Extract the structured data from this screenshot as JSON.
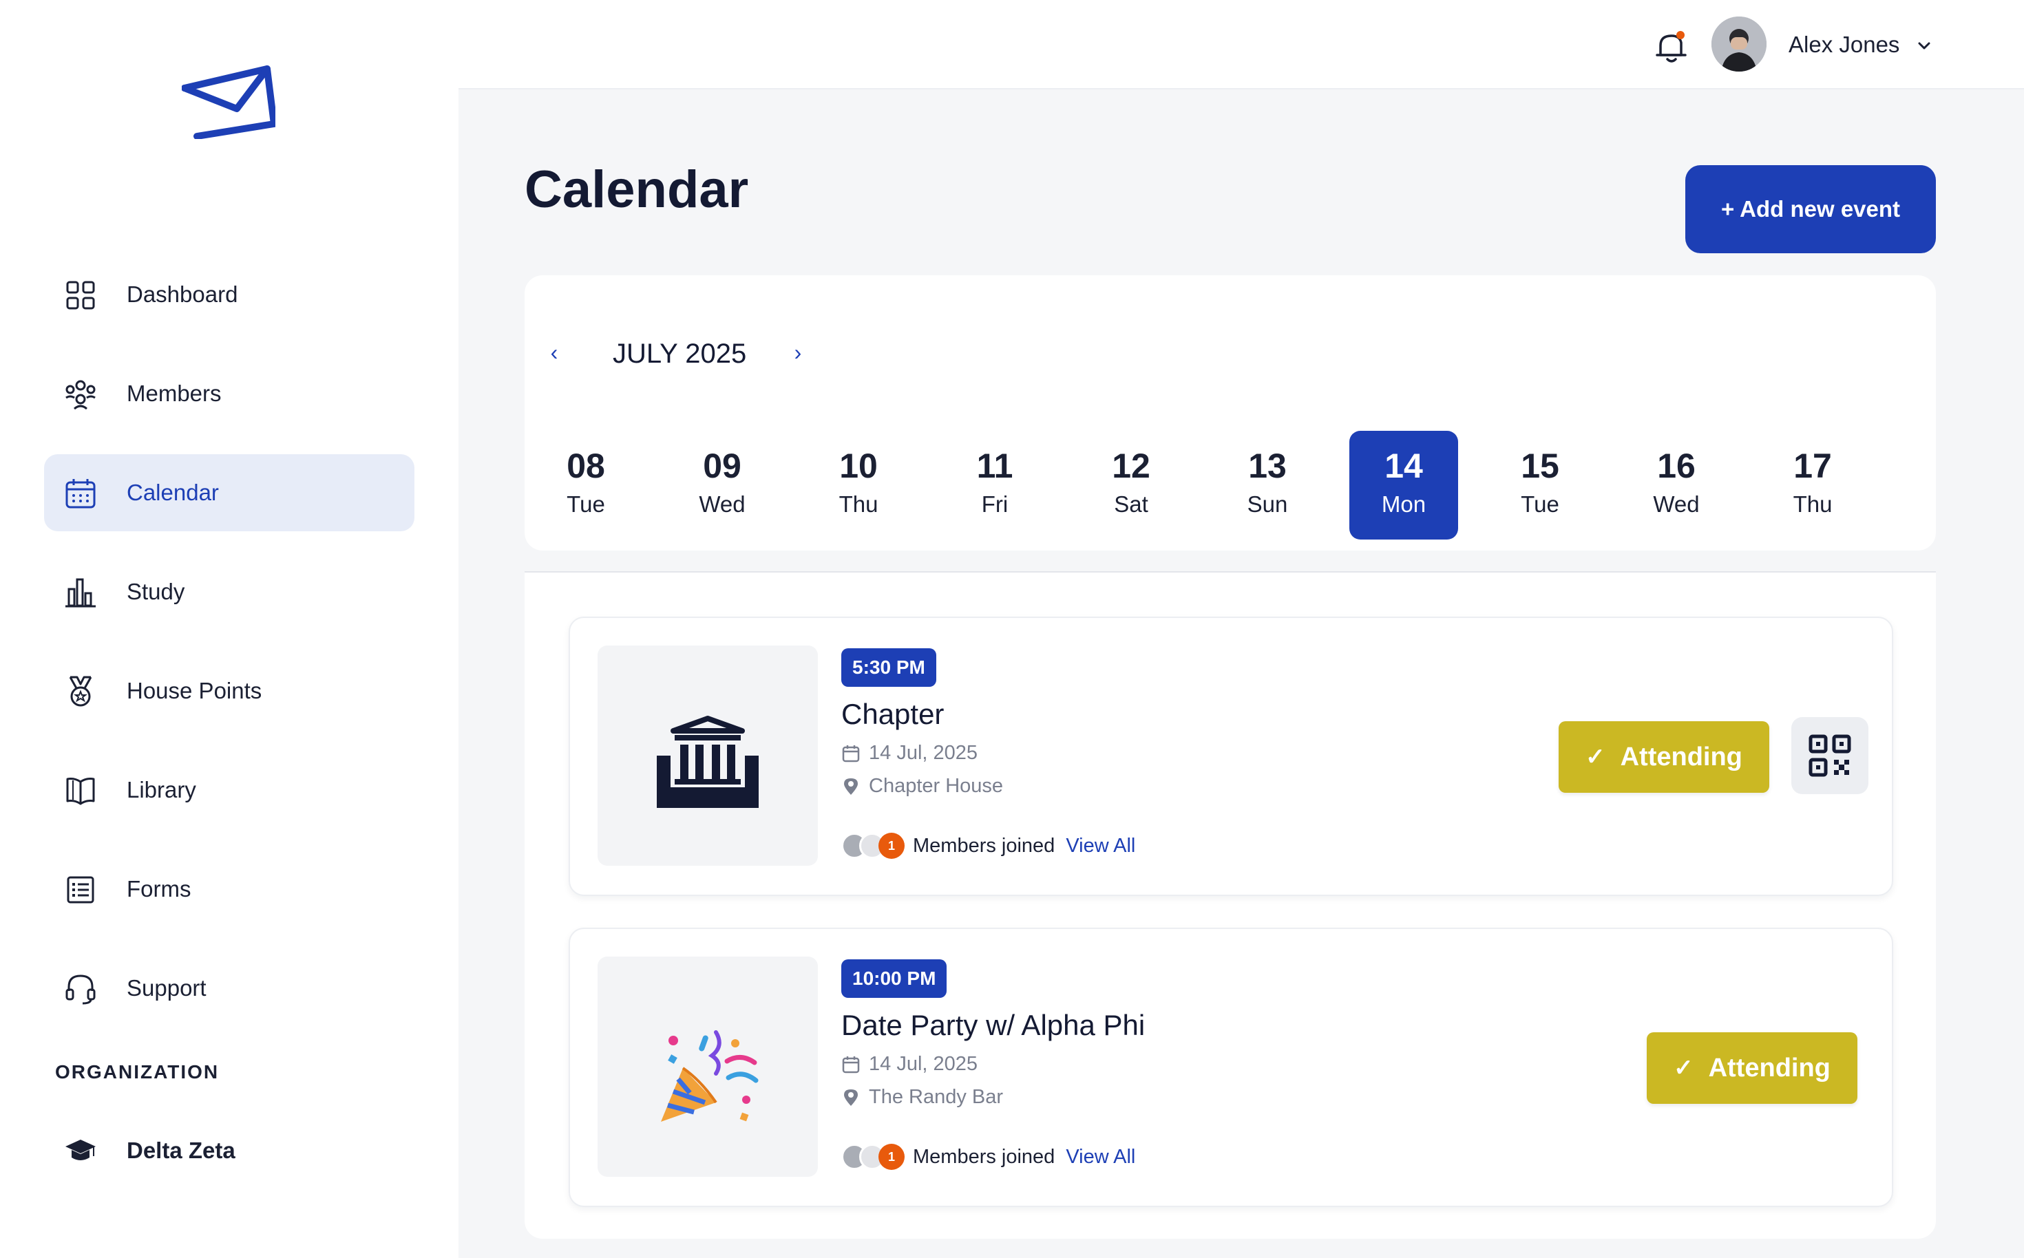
{
  "sidebar": {
    "nav": [
      {
        "label": "Dashboard",
        "icon": "grid-icon"
      },
      {
        "label": "Members",
        "icon": "members-icon"
      },
      {
        "label": "Calendar",
        "icon": "calendar-icon",
        "active": true
      },
      {
        "label": "Study",
        "icon": "bar-chart-icon"
      },
      {
        "label": "House Points",
        "icon": "medal-icon"
      },
      {
        "label": "Library",
        "icon": "book-icon"
      },
      {
        "label": "Forms",
        "icon": "form-list-icon"
      },
      {
        "label": "Support",
        "icon": "headset-icon"
      }
    ],
    "org_heading": "ORGANIZATION",
    "org_name": "Delta Zeta"
  },
  "header": {
    "user_name": "Alex Jones",
    "notification_dot_color": "#e85a0c"
  },
  "page": {
    "title": "Calendar",
    "add_button": "+ Add new event"
  },
  "calendar": {
    "month": "JULY 2025",
    "days": [
      {
        "num": "08",
        "dow": "Tue"
      },
      {
        "num": "09",
        "dow": "Wed"
      },
      {
        "num": "10",
        "dow": "Thu"
      },
      {
        "num": "11",
        "dow": "Fri"
      },
      {
        "num": "12",
        "dow": "Sat"
      },
      {
        "num": "13",
        "dow": "Sun"
      },
      {
        "num": "14",
        "dow": "Mon",
        "selected": true
      },
      {
        "num": "15",
        "dow": "Tue"
      },
      {
        "num": "16",
        "dow": "Wed"
      },
      {
        "num": "17",
        "dow": "Thu"
      }
    ]
  },
  "events": [
    {
      "time": "5:30 PM",
      "title": "Chapter",
      "date": "14 Jul, 2025",
      "location": "Chapter House",
      "member_count": "1",
      "members_label": "Members joined",
      "view_all": "View All",
      "status": "Attending",
      "thumb_icon": "building-icon",
      "has_qr": true
    },
    {
      "time": "10:00 PM",
      "title": "Date Party w/ Alpha Phi",
      "date": "14 Jul, 2025",
      "location": "The Randy Bar",
      "member_count": "1",
      "members_label": "Members joined",
      "view_all": "View All",
      "status": "Attending",
      "thumb_icon": "party-popper-icon",
      "has_qr": false
    }
  ],
  "colors": {
    "primary": "#1d3fb5",
    "attending": "#cbb823",
    "active_nav_bg": "#e7ecf8"
  }
}
